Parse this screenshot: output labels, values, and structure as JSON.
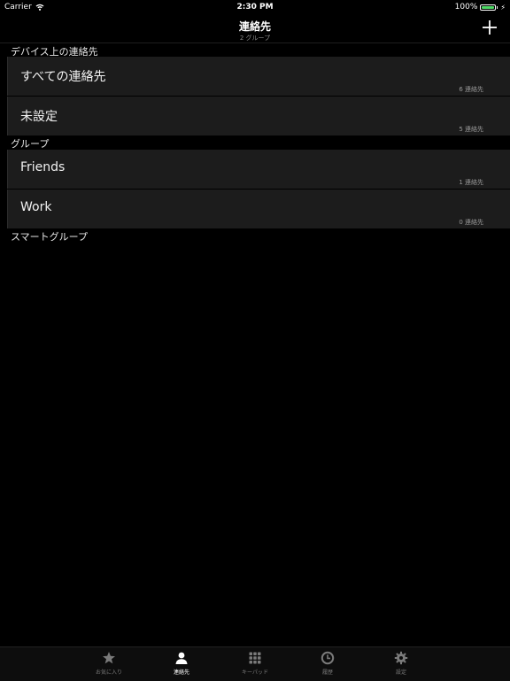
{
  "status_bar": {
    "carrier": "Carrier",
    "time": "2:30 PM",
    "battery": "100%",
    "battery_level": 1.0,
    "battery_color": "#4cd964"
  },
  "nav": {
    "title": "連絡先",
    "subtitle": "2 グループ",
    "add_icon": "plus-icon"
  },
  "sections": [
    {
      "header": "デバイス上の連絡先",
      "rows": [
        {
          "title": "すべての連絡先",
          "count": "6 連絡先"
        },
        {
          "title": "未設定",
          "count": "5 連絡先"
        }
      ]
    },
    {
      "header": "グループ",
      "rows": [
        {
          "title": "Friends",
          "count": "1 連絡先"
        },
        {
          "title": "Work",
          "count": "0 連絡先"
        }
      ]
    },
    {
      "header": "スマートグループ",
      "rows": []
    }
  ],
  "tabs": [
    {
      "label": "お気に入り",
      "icon": "star-icon",
      "active": false
    },
    {
      "label": "連絡先",
      "icon": "person-icon",
      "active": true
    },
    {
      "label": "キーパッド",
      "icon": "keypad-icon",
      "active": false
    },
    {
      "label": "履歴",
      "icon": "clock-icon",
      "active": false
    },
    {
      "label": "設定",
      "icon": "gear-icon",
      "active": false
    }
  ],
  "colors": {
    "background": "#000000",
    "row_background": "#1c1c1c",
    "active_tab": "#ffffff",
    "inactive_tab": "#7a7a7a"
  }
}
